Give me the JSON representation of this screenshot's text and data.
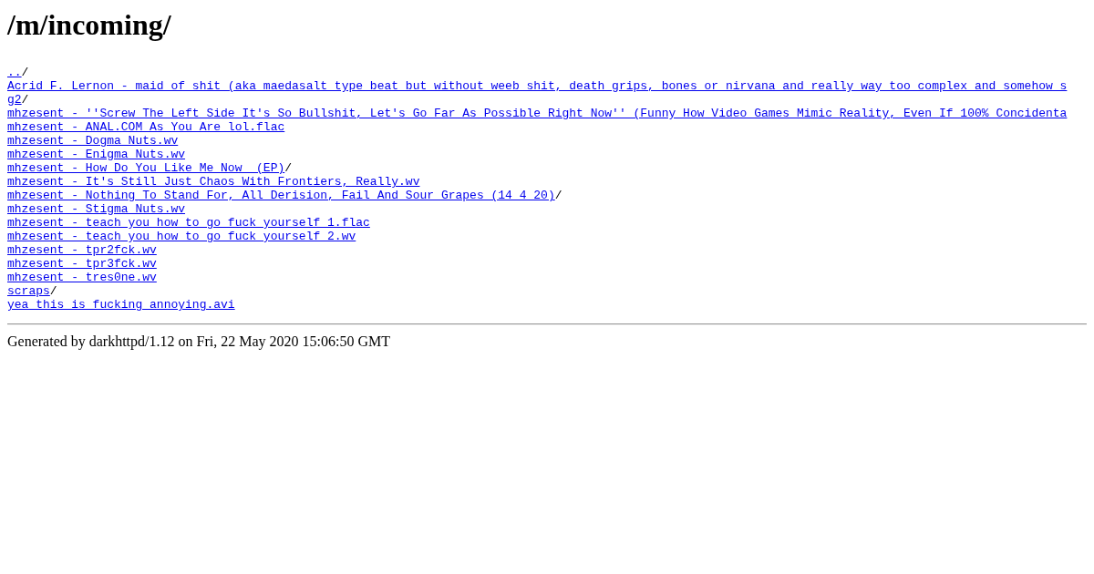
{
  "title": "/m/incoming/",
  "entries": [
    {
      "name": "..",
      "kind": "dir"
    },
    {
      "name": "Acrid F. Lernon - maid of shit (aka maedasalt type beat but without weeb shit, death grips, bones or nirvana and really way too complex and somehow s",
      "kind": "file"
    },
    {
      "name": "g2",
      "kind": "dir"
    },
    {
      "name": "mhzesent - ''Screw The Left Side It's So Bullshit, Let's Go Far As Possible Right Now'' (Funny How Video Games Mimic Reality, Even If 100% Concidenta",
      "kind": "file"
    },
    {
      "name": "mhzesent - ANAL.COM As You Are lol.flac",
      "kind": "file"
    },
    {
      "name": "mhzesent - Dogma Nuts.wv",
      "kind": "file"
    },
    {
      "name": "mhzesent - Enigma Nuts.wv",
      "kind": "file"
    },
    {
      "name": "mhzesent - How Do You Like Me Now  (EP)",
      "kind": "dir"
    },
    {
      "name": "mhzesent - It's Still Just Chaos With Frontiers, Really.wv",
      "kind": "file"
    },
    {
      "name": "mhzesent - Nothing To Stand For, All Derision, Fail And Sour Grapes (14 4 20)",
      "kind": "dir"
    },
    {
      "name": "mhzesent - Stigma Nuts.wv",
      "kind": "file"
    },
    {
      "name": "mhzesent - teach you how to go fuck yourself 1.flac",
      "kind": "file"
    },
    {
      "name": "mhzesent - teach you how to go fuck yourself 2.wv",
      "kind": "file"
    },
    {
      "name": "mhzesent - tpr2fck.wv",
      "kind": "file"
    },
    {
      "name": "mhzesent - tpr3fck.wv",
      "kind": "file"
    },
    {
      "name": "mhzesent - tres0ne.wv",
      "kind": "file"
    },
    {
      "name": "scraps",
      "kind": "dir"
    },
    {
      "name": "yea this is fucking annoying.avi",
      "kind": "file"
    }
  ],
  "dir_suffix": "/",
  "footer": "Generated by darkhttpd/1.12 on Fri, 22 May 2020 15:06:50 GMT"
}
